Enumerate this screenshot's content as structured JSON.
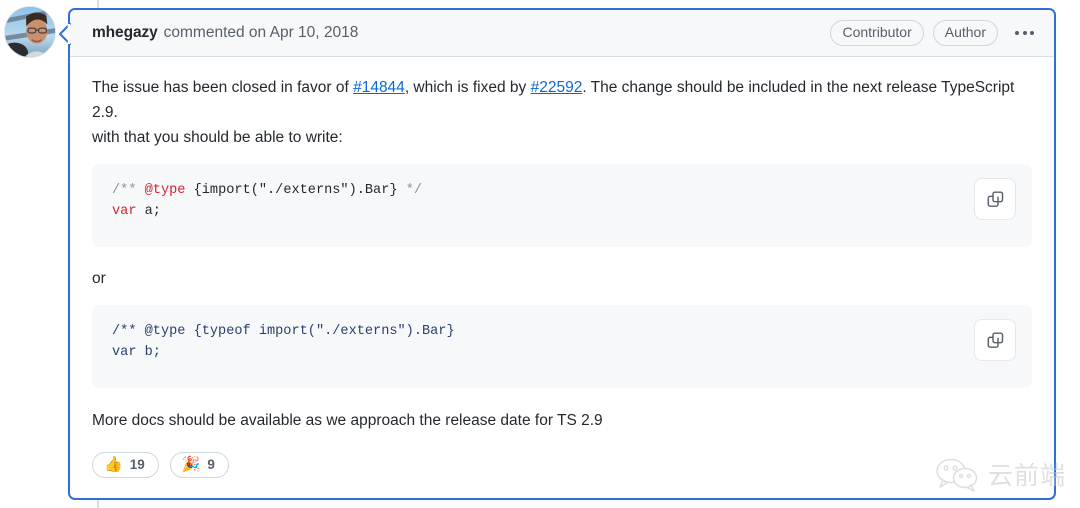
{
  "comment": {
    "author": "mhegazy",
    "commented_on": "commented on Apr 10, 2018",
    "badges": [
      "Contributor",
      "Author"
    ],
    "menu_icon": "kebab-horizontal-icon",
    "avatar_icon": "user-avatar-photo"
  },
  "body": {
    "paragraph1": {
      "text_1": "The issue has been closed in favor of ",
      "link_1": "#14844",
      "text_2": ", which is fixed by ",
      "link_2": "#22592",
      "text_3": ". The change should be included in the next release TypeScript 2.9."
    },
    "paragraph2": "with that you should be able to write:",
    "or_text": "or",
    "closing_text": "More docs should be available as we approach the release date for TS 2.9"
  },
  "code_blocks": [
    {
      "copy_label": "copy-icon",
      "line1": {
        "comment_open": "/** ",
        "tag": "@type",
        "plain": " {import(\"./externs\").Bar} ",
        "comment_close": "*/"
      },
      "line2": {
        "keyword": "var",
        "rest": " a;"
      }
    },
    {
      "copy_label": "copy-icon",
      "line1": "/** @type {typeof import(\"./externs\").Bar}",
      "line2": "var b;"
    }
  ],
  "reactions": [
    {
      "emoji": "👍",
      "name": "thumbs-up",
      "count": "19"
    },
    {
      "emoji": "🎉",
      "name": "tada",
      "count": "9"
    }
  ],
  "watermark": {
    "icon": "wechat-logo-icon",
    "text": "云前端"
  },
  "colors": {
    "comment_border": "#316ed6",
    "link": "#0969da",
    "code_bg": "#f6f8fa",
    "header_bg": "#f6f8fa",
    "keyword_red": "#d1242f",
    "code_blue": "#2b3f6c",
    "muted_text": "#57606a"
  }
}
